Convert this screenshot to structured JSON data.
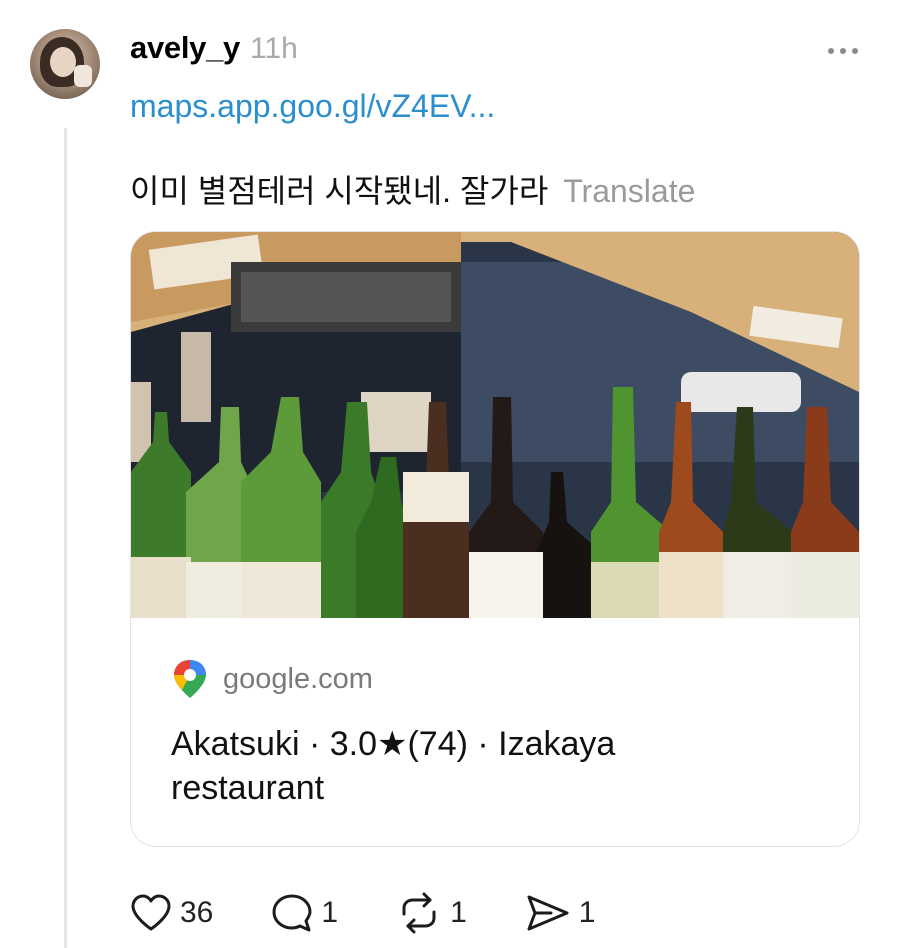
{
  "post": {
    "username": "avely_y",
    "time": "11h",
    "link": "maps.app.goo.gl/vZ4EV...",
    "text": "이미 별점테러 시작됐네. 잘가라",
    "translate_label": "Translate"
  },
  "card": {
    "source": "google.com",
    "title_line1": "Akatsuki · 3.0★(74) · Izakaya",
    "title_line2": "restaurant"
  },
  "actions": {
    "likes": "36",
    "replies": "1",
    "reposts": "1",
    "shares": "1"
  },
  "colors": {
    "link": "#2b8fce",
    "muted": "#a9a9a9",
    "thread_line": "#e6e6e6"
  },
  "icons": [
    "more-icon",
    "maps-pin-icon",
    "heart-icon",
    "comment-icon",
    "repost-icon",
    "share-icon"
  ]
}
